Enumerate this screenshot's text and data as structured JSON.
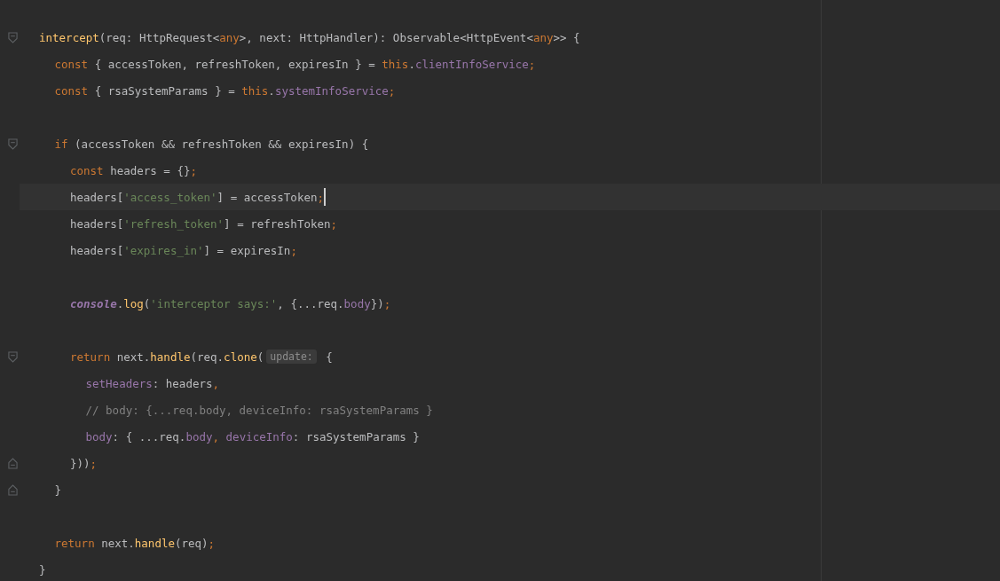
{
  "editor": {
    "lines": [
      {
        "kind": "fold-start",
        "current": false,
        "tokens": [
          {
            "text": "intercept",
            "kind": "fn"
          },
          {
            "text": "(req: HttpRequest<",
            "kind": "plain"
          },
          {
            "text": "any",
            "kind": "kw"
          },
          {
            "text": ">, next: HttpHandler): Observable<HttpEvent<",
            "kind": "plain"
          },
          {
            "text": "any",
            "kind": "kw"
          },
          {
            "text": ">> {",
            "kind": "plain"
          }
        ],
        "children": [
          {
            "kind": "code",
            "current": false,
            "tokens": [
              {
                "text": "const",
                "kind": "kw"
              },
              {
                "text": " { accessToken, refreshToken, expiresIn } = ",
                "kind": "plain"
              },
              {
                "text": "this",
                "kind": "kw"
              },
              {
                "text": ".",
                "kind": "plain"
              },
              {
                "text": "clientInfoService",
                "kind": "prop"
              },
              {
                "text": ";",
                "kind": "kw"
              }
            ]
          },
          {
            "kind": "code",
            "current": false,
            "tokens": [
              {
                "text": "const",
                "kind": "kw"
              },
              {
                "text": " { rsaSystemParams } = ",
                "kind": "plain"
              },
              {
                "text": "this",
                "kind": "kw"
              },
              {
                "text": ".",
                "kind": "plain"
              },
              {
                "text": "systemInfoService",
                "kind": "prop"
              },
              {
                "text": ";",
                "kind": "kw"
              }
            ]
          },
          {
            "kind": "blank",
            "current": false
          },
          {
            "kind": "fold-start",
            "current": false,
            "tokens": [
              {
                "text": "if",
                "kind": "kw"
              },
              {
                "text": " (accessToken && refreshToken && expiresIn) {",
                "kind": "plain"
              }
            ],
            "children": [
              {
                "kind": "code",
                "current": false,
                "tokens": [
                  {
                    "text": "const",
                    "kind": "kw"
                  },
                  {
                    "text": " headers = {}",
                    "kind": "plain"
                  },
                  {
                    "text": ";",
                    "kind": "kw"
                  }
                ]
              },
              {
                "kind": "code",
                "current": true,
                "tokens": [
                  {
                    "text": "headers[",
                    "kind": "plain"
                  },
                  {
                    "text": "'access_token'",
                    "kind": "str"
                  },
                  {
                    "text": "] = accessToken",
                    "kind": "plain"
                  },
                  {
                    "text": ";",
                    "kind": "kw"
                  }
                ]
              },
              {
                "kind": "code",
                "current": false,
                "tokens": [
                  {
                    "text": "headers[",
                    "kind": "plain"
                  },
                  {
                    "text": "'refresh_token'",
                    "kind": "str"
                  },
                  {
                    "text": "] = refreshToken",
                    "kind": "plain"
                  },
                  {
                    "text": ";",
                    "kind": "kw"
                  }
                ]
              },
              {
                "kind": "code",
                "current": false,
                "tokens": [
                  {
                    "text": "headers[",
                    "kind": "plain"
                  },
                  {
                    "text": "'expires_in'",
                    "kind": "str"
                  },
                  {
                    "text": "] = expiresIn",
                    "kind": "plain"
                  },
                  {
                    "text": ";",
                    "kind": "kw"
                  }
                ]
              },
              {
                "kind": "blank",
                "current": false
              },
              {
                "kind": "code",
                "current": false,
                "tokens": [
                  {
                    "text": "console",
                    "kind": "global"
                  },
                  {
                    "text": ".",
                    "kind": "plain"
                  },
                  {
                    "text": "log",
                    "kind": "fn"
                  },
                  {
                    "text": "(",
                    "kind": "plain"
                  },
                  {
                    "text": "'interceptor says:'",
                    "kind": "str"
                  },
                  {
                    "text": ", {...req.",
                    "kind": "plain"
                  },
                  {
                    "text": "body",
                    "kind": "prop"
                  },
                  {
                    "text": "})",
                    "kind": "plain"
                  },
                  {
                    "text": ";",
                    "kind": "kw"
                  }
                ]
              },
              {
                "kind": "blank",
                "current": false
              },
              {
                "kind": "fold-start",
                "current": false,
                "tokens": [
                  {
                    "text": "return",
                    "kind": "kw"
                  },
                  {
                    "text": " next.",
                    "kind": "plain"
                  },
                  {
                    "text": "handle",
                    "kind": "fn"
                  },
                  {
                    "text": "(req.",
                    "kind": "plain"
                  },
                  {
                    "text": "clone",
                    "kind": "fn"
                  },
                  {
                    "text": "(",
                    "kind": "plain"
                  },
                  {
                    "text": "update:",
                    "kind": "hint"
                  },
                  {
                    "text": " {",
                    "kind": "plain"
                  }
                ],
                "children": [
                  {
                    "kind": "code",
                    "current": false,
                    "tokens": [
                      {
                        "text": "setHeaders",
                        "kind": "prop"
                      },
                      {
                        "text": ": headers",
                        "kind": "plain"
                      },
                      {
                        "text": ",",
                        "kind": "kw"
                      }
                    ]
                  },
                  {
                    "kind": "code",
                    "current": false,
                    "tokens": [
                      {
                        "text": "// body: {...req.body, deviceInfo: rsaSystemParams }",
                        "kind": "comment"
                      }
                    ]
                  },
                  {
                    "kind": "code",
                    "current": false,
                    "tokens": [
                      {
                        "text": "body",
                        "kind": "prop"
                      },
                      {
                        "text": ": { ...req.",
                        "kind": "plain"
                      },
                      {
                        "text": "body",
                        "kind": "prop"
                      },
                      {
                        "text": ", ",
                        "kind": "kw"
                      },
                      {
                        "text": "deviceInfo",
                        "kind": "prop"
                      },
                      {
                        "text": ": rsaSystemParams }",
                        "kind": "plain"
                      }
                    ]
                  }
                ]
              },
              {
                "kind": "fold-end",
                "current": false,
                "tokens": [
                  {
                    "text": "}))",
                    "kind": "plain"
                  },
                  {
                    "text": ";",
                    "kind": "kw"
                  }
                ]
              }
            ]
          },
          {
            "kind": "fold-end",
            "current": false,
            "tokens": [
              {
                "text": "}",
                "kind": "plain"
              }
            ]
          },
          {
            "kind": "blank",
            "current": false
          },
          {
            "kind": "code",
            "current": false,
            "tokens": [
              {
                "text": "return",
                "kind": "kw"
              },
              {
                "text": " next.",
                "kind": "plain"
              },
              {
                "text": "handle",
                "kind": "fn"
              },
              {
                "text": "(req)",
                "kind": "plain"
              },
              {
                "text": ";",
                "kind": "kw"
              }
            ]
          }
        ]
      },
      {
        "kind": "code",
        "current": false,
        "tokens": [
          {
            "text": "}",
            "kind": "plain"
          }
        ]
      }
    ]
  }
}
